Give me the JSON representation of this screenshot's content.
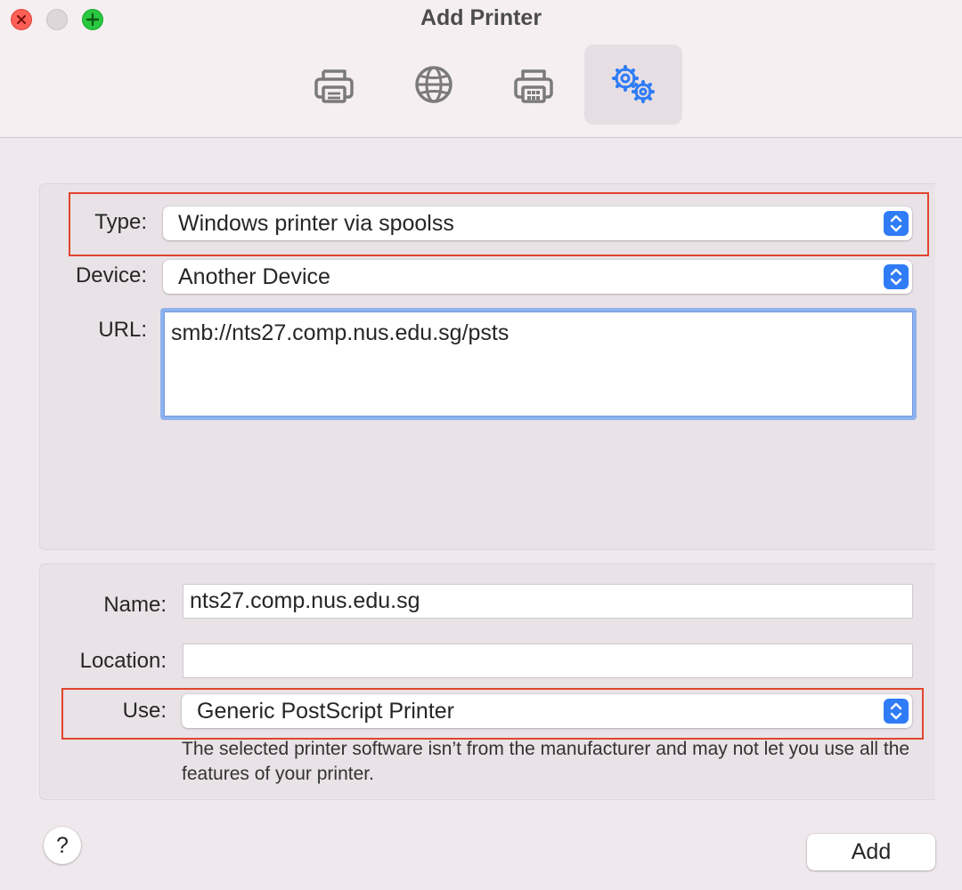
{
  "window": {
    "title": "Add Printer",
    "toolbar": [
      {
        "icon": "default-printer-icon",
        "selected": false
      },
      {
        "icon": "ip-globe-icon",
        "selected": false
      },
      {
        "icon": "windows-printer-icon",
        "selected": false
      },
      {
        "icon": "advanced-gears-icon",
        "selected": true
      }
    ]
  },
  "connection": {
    "type_label": "Type:",
    "type_value": "Windows printer via spoolss",
    "device_label": "Device:",
    "device_value": "Another Device",
    "url_label": "URL:",
    "url_value": "smb://nts27.comp.nus.edu.sg/psts"
  },
  "details": {
    "name_label": "Name:",
    "name_value": "nts27.comp.nus.edu.sg",
    "location_label": "Location:",
    "location_value": "",
    "use_label": "Use:",
    "use_value": "Generic PostScript Printer",
    "note": "The selected printer software isn’t from the manufacturer and may not let you use all the features of your printer."
  },
  "buttons": {
    "help": "?",
    "add": "Add"
  },
  "colors": {
    "accent": "#2f7cf6",
    "highlight": "#e0452e",
    "close": "#fe5f57",
    "zoom": "#29c840"
  }
}
